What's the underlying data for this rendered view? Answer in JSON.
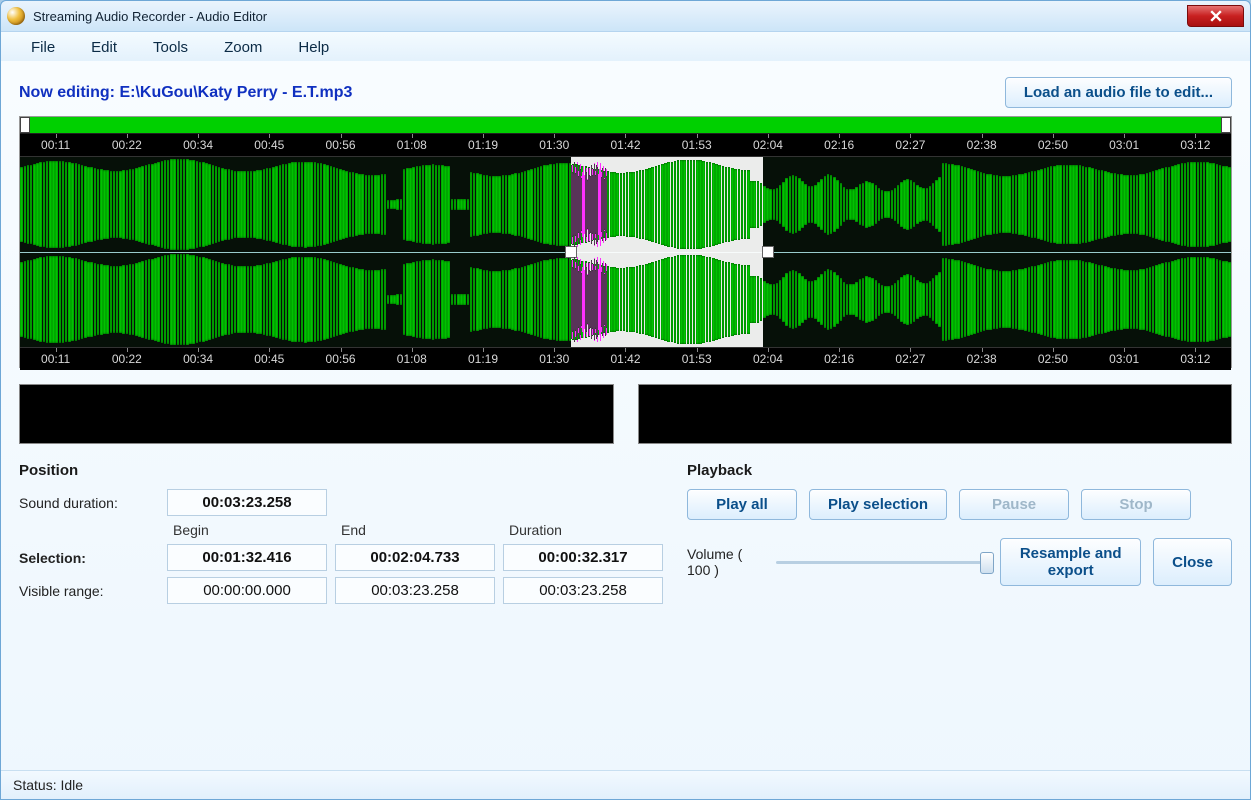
{
  "window": {
    "title": "Streaming Audio Recorder - Audio Editor"
  },
  "menu": {
    "items": [
      "File",
      "Edit",
      "Tools",
      "Zoom",
      "Help"
    ]
  },
  "header": {
    "now_editing_prefix": "Now editing: ",
    "now_editing_path": "E:\\KuGou\\Katy Perry - E.T.mp3",
    "load_button": "Load an audio file to edit..."
  },
  "ruler": {
    "ticks": [
      "00:11",
      "00:22",
      "00:34",
      "00:45",
      "00:56",
      "01:08",
      "01:19",
      "01:30",
      "01:42",
      "01:53",
      "02:04",
      "02:16",
      "02:27",
      "02:38",
      "02:50",
      "03:01",
      "03:12"
    ]
  },
  "waveform": {
    "total_seconds": 203.258,
    "selection_start_seconds": 92.416,
    "selection_end_seconds": 124.733
  },
  "position": {
    "title": "Position",
    "sound_duration_label": "Sound duration:",
    "sound_duration": "00:03:23.258",
    "col_begin": "Begin",
    "col_end": "End",
    "col_duration": "Duration",
    "selection_label": "Selection:",
    "selection_begin": "00:01:32.416",
    "selection_end": "00:02:04.733",
    "selection_duration": "00:00:32.317",
    "visible_label": "Visible range:",
    "visible_begin": "00:00:00.000",
    "visible_end": "00:03:23.258",
    "visible_duration": "00:03:23.258"
  },
  "playback": {
    "title": "Playback",
    "play_all": "Play all",
    "play_selection": "Play selection",
    "pause": "Pause",
    "stop": "Stop",
    "volume_label": "Volume ( 100 )",
    "volume_value": 100,
    "resample": "Resample and export",
    "close": "Close"
  },
  "status": {
    "text": "Status: Idle"
  }
}
